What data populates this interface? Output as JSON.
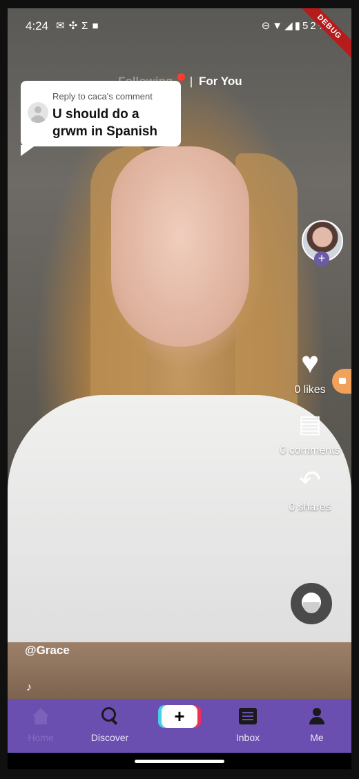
{
  "status_bar": {
    "time": "4:24",
    "left_icons": [
      "gmail-icon",
      "pinwheel-icon",
      "sigma-icon",
      "video-camera-icon"
    ],
    "right_icons": [
      "do-not-disturb-icon",
      "wifi-icon",
      "signal-icon",
      "battery-icon"
    ],
    "battery": "52%",
    "debug_banner": "DEBUG"
  },
  "top_tabs": {
    "following": "Following",
    "for_you": "For You",
    "separator": "|"
  },
  "comment_bubble": {
    "reply_to": "Reply to caca's comment",
    "comment": "U should do a grwm in Spanish"
  },
  "actions": {
    "likes": "0 likes",
    "comments": "0 comments",
    "shares": "0 shares",
    "follow_plus": "+"
  },
  "video": {
    "username": "@Grace",
    "music_icon": "♪"
  },
  "bottom_nav": {
    "home": "Home",
    "discover": "Discover",
    "create": "+",
    "inbox": "Inbox",
    "me": "Me"
  }
}
